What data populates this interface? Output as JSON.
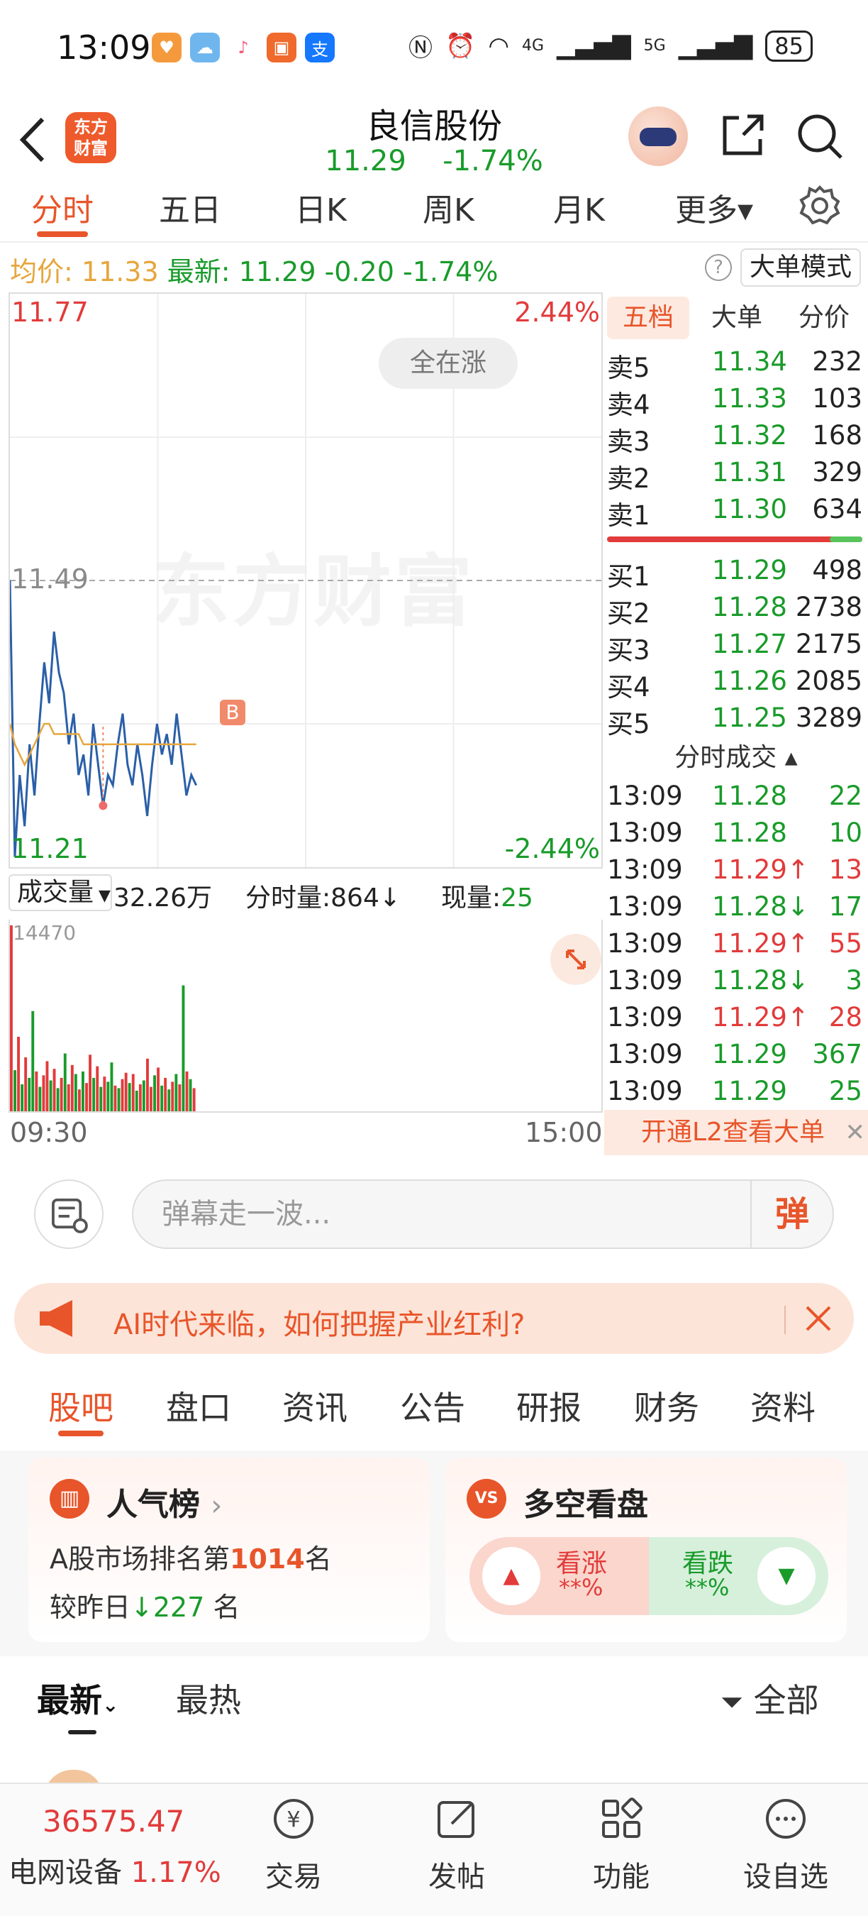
{
  "status_bar": {
    "time": "13:09",
    "battery": "85",
    "net1": "4G",
    "net2": "5G"
  },
  "header": {
    "logo_line1": "东方",
    "logo_line2": "财富",
    "stock_name": "良信股份",
    "price": "11.29",
    "change_pct": "-1.74%"
  },
  "period_tabs": [
    "分时",
    "五日",
    "日K",
    "周K",
    "月K",
    "更多▾"
  ],
  "quote_line": {
    "avg_label": "均价:",
    "avg_value": "11.33",
    "latest_label": "最新:",
    "latest_value": "11.29",
    "change": "-0.20",
    "change_pct": "-1.74%",
    "help": "?",
    "mode_button": "大单模式"
  },
  "chart": {
    "price_high": "11.77",
    "pct_high": "2.44%",
    "price_mid": "11.49",
    "price_low": "11.21",
    "pct_low": "-2.44%",
    "all_up_button": "全在涨",
    "watermark": "东方财富",
    "marker": "B",
    "time_start": "09:30",
    "time_end": "15:00"
  },
  "volume_bar": {
    "selector": "成交量",
    "total": "32.26万",
    "tick_label": "分时量:864",
    "tick_arrow": "↓",
    "now_label": "现量:",
    "now_value": "25",
    "max_label": "14470"
  },
  "chart_data": {
    "type": "line",
    "title": "",
    "xlabel": "",
    "ylabel": "",
    "ylim": [
      11.21,
      11.77
    ],
    "reference": 11.49,
    "series": [
      {
        "name": "price",
        "values": [
          11.49,
          11.22,
          11.3,
          11.25,
          11.33,
          11.28,
          11.35,
          11.41,
          11.37,
          11.44,
          11.4,
          11.38,
          11.33,
          11.36,
          11.3,
          11.32,
          11.28,
          11.35,
          11.31,
          11.27,
          11.3,
          11.29,
          11.33,
          11.36,
          11.31,
          11.29,
          11.33,
          11.3,
          11.26,
          11.31,
          11.35,
          11.32,
          11.34,
          11.31,
          11.36,
          11.32,
          11.28,
          11.3,
          11.29
        ]
      },
      {
        "name": "avg",
        "values": [
          11.35,
          11.33,
          11.32,
          11.31,
          11.32,
          11.33,
          11.34,
          11.35,
          11.35,
          11.34,
          11.34,
          11.34,
          11.34,
          11.34,
          11.34,
          11.33,
          11.33,
          11.33,
          11.33,
          11.33,
          11.33,
          11.33,
          11.33,
          11.33,
          11.33,
          11.33,
          11.33,
          11.33,
          11.33,
          11.33,
          11.33,
          11.33,
          11.33,
          11.33,
          11.33,
          11.33,
          11.33,
          11.33,
          11.33
        ]
      }
    ],
    "volume": {
      "max": 14470,
      "values": [
        14470,
        3200,
        5800,
        2100,
        4200,
        2600,
        7800,
        3100,
        1900,
        2800,
        3900,
        2400,
        3300,
        1800,
        2600,
        4500,
        2100,
        3600,
        2900,
        1700,
        3100,
        2200,
        4400,
        2600,
        3500,
        1900,
        2700,
        2300,
        3800,
        2000,
        1800,
        2500,
        3000,
        2200,
        2900,
        1600,
        2100,
        2400,
        4100,
        1900,
        2800,
        3400,
        2000,
        2600,
        1700,
        2300,
        2900,
        2100,
        9800,
        3100,
        2500,
        1800
      ],
      "colors": [
        "red",
        "green",
        "red",
        "green",
        "red",
        "green",
        "green",
        "red",
        "green",
        "red",
        "red",
        "green",
        "red",
        "green",
        "red",
        "green",
        "red",
        "red",
        "green",
        "red",
        "green",
        "red",
        "red",
        "green",
        "red",
        "green",
        "red",
        "green",
        "green",
        "red",
        "green",
        "red",
        "red",
        "green",
        "red",
        "green",
        "red",
        "green",
        "red",
        "red",
        "green",
        "red",
        "green",
        "red",
        "green",
        "red",
        "green",
        "red",
        "green",
        "red",
        "green",
        "red"
      ]
    }
  },
  "order_book": {
    "tabs": [
      "五档",
      "大单",
      "分价"
    ],
    "asks": [
      {
        "label": "卖5",
        "price": "11.34",
        "vol": "232"
      },
      {
        "label": "卖4",
        "price": "11.33",
        "vol": "103"
      },
      {
        "label": "卖3",
        "price": "11.32",
        "vol": "168"
      },
      {
        "label": "卖2",
        "price": "11.31",
        "vol": "329"
      },
      {
        "label": "卖1",
        "price": "11.30",
        "vol": "634"
      }
    ],
    "bids": [
      {
        "label": "买1",
        "price": "11.29",
        "vol": "498"
      },
      {
        "label": "买2",
        "price": "11.28",
        "vol": "2738"
      },
      {
        "label": "买3",
        "price": "11.27",
        "vol": "2175"
      },
      {
        "label": "买4",
        "price": "11.26",
        "vol": "2085"
      },
      {
        "label": "买5",
        "price": "11.25",
        "vol": "3289"
      }
    ],
    "ticks_title": "分时成交 ▴",
    "ticks": [
      {
        "time": "13:09",
        "price": "11.28",
        "vol": "22",
        "dir": "green"
      },
      {
        "time": "13:09",
        "price": "11.28",
        "vol": "10",
        "dir": "green"
      },
      {
        "time": "13:09",
        "price": "11.29↑",
        "vol": "13",
        "dir": "red"
      },
      {
        "time": "13:09",
        "price": "11.28↓",
        "vol": "17",
        "dir": "green"
      },
      {
        "time": "13:09",
        "price": "11.29↑",
        "vol": "55",
        "dir": "red"
      },
      {
        "time": "13:09",
        "price": "11.28↓",
        "vol": "3",
        "dir": "green"
      },
      {
        "time": "13:09",
        "price": "11.29↑",
        "vol": "28",
        "dir": "red"
      },
      {
        "time": "13:09",
        "price": "11.29",
        "vol": "367",
        "dir": "green"
      },
      {
        "time": "13:09",
        "price": "11.29",
        "vol": "25",
        "dir": "green"
      }
    ],
    "l2_text": "开通L2查看大单",
    "l2_close": "✕"
  },
  "danmu": {
    "placeholder": "弹幕走一波...",
    "send_label": "弹"
  },
  "ai_banner": {
    "text": "AI时代来临，如何把握产业红利?"
  },
  "section_tabs": [
    "股吧",
    "盘口",
    "资讯",
    "公告",
    "研报",
    "财务",
    "资料"
  ],
  "popularity": {
    "title": "人气榜",
    "chevron": "›",
    "rank_prefix": "A股市场排名第",
    "rank": "1014",
    "rank_suffix": "名",
    "change_prefix": "较昨日",
    "change_arrow": "↓",
    "change_value": "227",
    "change_suffix": " 名"
  },
  "bull_bear": {
    "title": "多空看盘",
    "vs": "VS",
    "up_label": "看涨",
    "up_value": "**%",
    "down_label": "看跌",
    "down_value": "**%"
  },
  "list_tabs": {
    "latest": "最新",
    "hot": "最热",
    "filter": "全部"
  },
  "bottom_bar": {
    "index_value": "36575.47",
    "sector_name": "电网设备",
    "sector_change": "1.17%",
    "items": [
      "交易",
      "发帖",
      "功能",
      "设自选"
    ]
  },
  "colors": {
    "accent": "#e8552a",
    "up": "#e23b3b",
    "down": "#199b2a",
    "avg": "#e6a63d",
    "price_line": "#2b5fa8"
  }
}
